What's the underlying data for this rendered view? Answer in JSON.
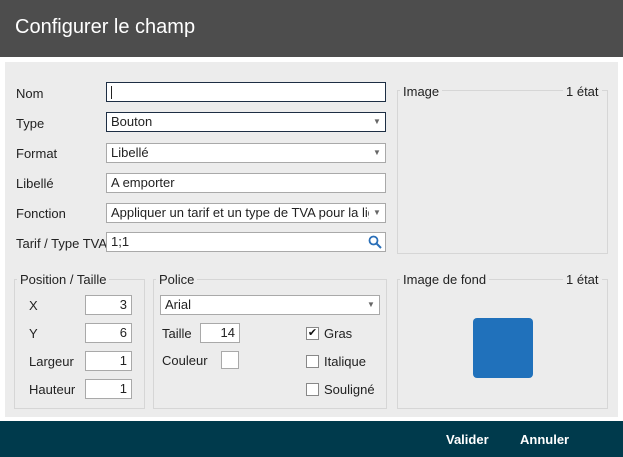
{
  "dialog": {
    "title": "Configurer le champ"
  },
  "form": {
    "nom": {
      "label": "Nom",
      "value": ""
    },
    "type": {
      "label": "Type",
      "value": "Bouton"
    },
    "format": {
      "label": "Format",
      "value": "Libellé"
    },
    "libelle": {
      "label": "Libellé",
      "value": "A emporter"
    },
    "fonction": {
      "label": "Fonction",
      "value": "Appliquer un tarif et un type de TVA pour la ligne"
    },
    "tarif": {
      "label": "Tarif / Type TVA",
      "value": "1;1"
    }
  },
  "image": {
    "title": "Image",
    "states": "1 état"
  },
  "position": {
    "title": "Position / Taille",
    "x": {
      "label": "X",
      "value": "3"
    },
    "y": {
      "label": "Y",
      "value": "6"
    },
    "largeur": {
      "label": "Largeur",
      "value": "1"
    },
    "hauteur": {
      "label": "Hauteur",
      "value": "1"
    }
  },
  "police": {
    "title": "Police",
    "font": "Arial",
    "taille": {
      "label": "Taille",
      "value": "14"
    },
    "couleur": {
      "label": "Couleur"
    },
    "gras": {
      "label": "Gras",
      "checked": true
    },
    "italique": {
      "label": "Italique",
      "checked": false
    },
    "souligne": {
      "label": "Souligné",
      "checked": false
    }
  },
  "background_image": {
    "title": "Image de fond",
    "states": "1 état",
    "color": "#2071bb"
  },
  "footer": {
    "validate": "Valider",
    "cancel": "Annuler"
  }
}
